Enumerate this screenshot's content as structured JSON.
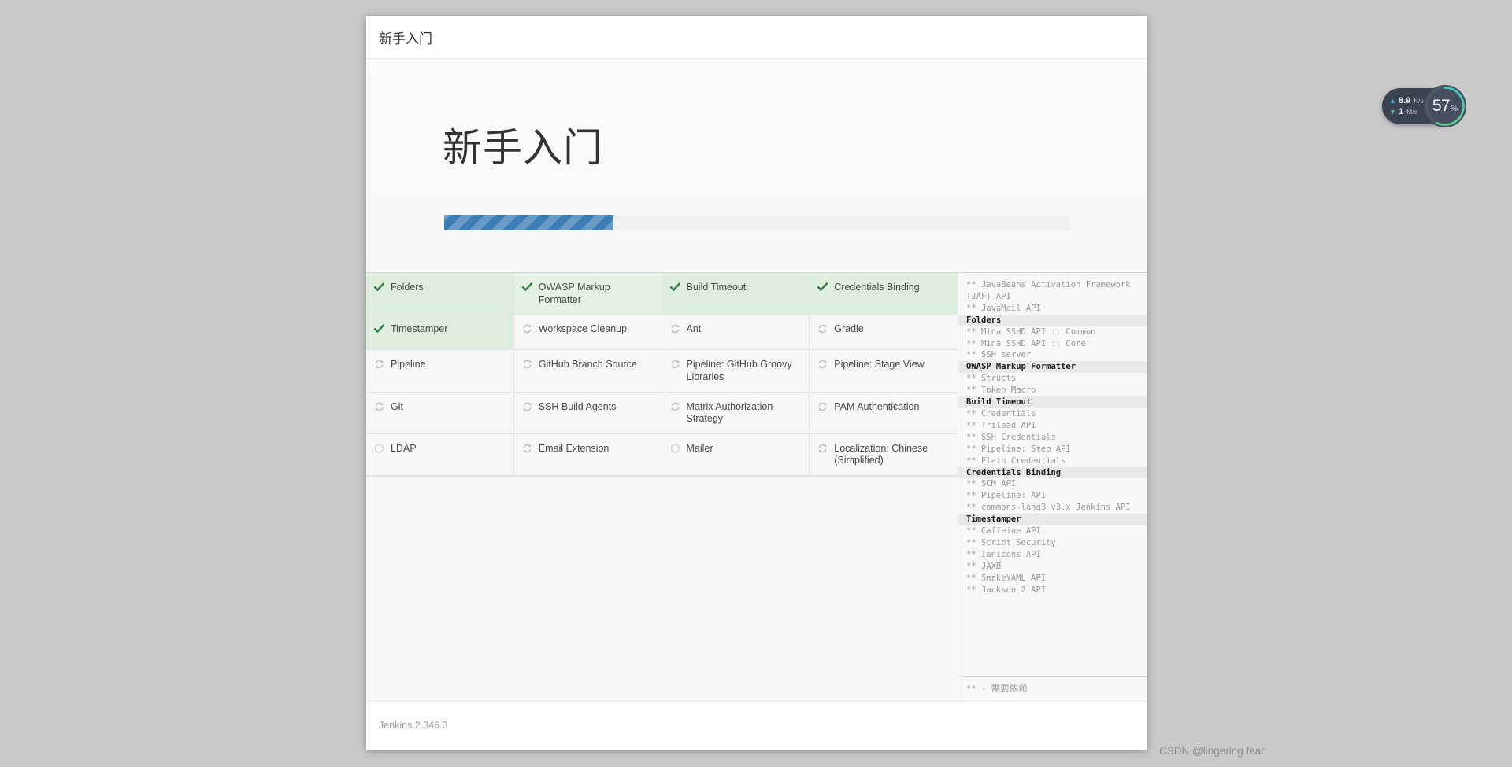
{
  "window": {
    "breadcrumb": "新手入门",
    "hero_title": "新手入门",
    "progress_percent": 27,
    "footer_version": "Jenkins 2.346.3"
  },
  "plugins": [
    {
      "name": "Folders",
      "status": "done"
    },
    {
      "name": "OWASP Markup Formatter",
      "status": "done"
    },
    {
      "name": "Build Timeout",
      "status": "done"
    },
    {
      "name": "Credentials Binding",
      "status": "done"
    },
    {
      "name": "Timestamper",
      "status": "done"
    },
    {
      "name": "Workspace Cleanup",
      "status": "installing"
    },
    {
      "name": "Ant",
      "status": "installing"
    },
    {
      "name": "Gradle",
      "status": "installing"
    },
    {
      "name": "Pipeline",
      "status": "installing"
    },
    {
      "name": "GitHub Branch Source",
      "status": "installing"
    },
    {
      "name": "Pipeline: GitHub Groovy Libraries",
      "status": "installing"
    },
    {
      "name": "Pipeline: Stage View",
      "status": "installing"
    },
    {
      "name": "Git",
      "status": "installing"
    },
    {
      "name": "SSH Build Agents",
      "status": "installing"
    },
    {
      "name": "Matrix Authorization Strategy",
      "status": "installing"
    },
    {
      "name": "PAM Authentication",
      "status": "installing"
    },
    {
      "name": "LDAP",
      "status": "pending"
    },
    {
      "name": "Email Extension",
      "status": "installing"
    },
    {
      "name": "Mailer",
      "status": "pending"
    },
    {
      "name": "Localization: Chinese (Simplified)",
      "status": "installing"
    }
  ],
  "install_log": {
    "lines": [
      {
        "text": "** JavaBeans Activation Framework (JAF) API",
        "type": "dep"
      },
      {
        "text": "** JavaMail API",
        "type": "dep"
      },
      {
        "text": "Folders",
        "type": "plug"
      },
      {
        "text": "** Mina SSHD API :: Common",
        "type": "dep"
      },
      {
        "text": "** Mina SSHD API :: Core",
        "type": "dep"
      },
      {
        "text": "** SSH server",
        "type": "dep"
      },
      {
        "text": "OWASP Markup Formatter",
        "type": "plug"
      },
      {
        "text": "** Structs",
        "type": "dep"
      },
      {
        "text": "** Token Macro",
        "type": "dep"
      },
      {
        "text": "Build Timeout",
        "type": "plug"
      },
      {
        "text": "** Credentials",
        "type": "dep"
      },
      {
        "text": "** Trilead API",
        "type": "dep"
      },
      {
        "text": "** SSH Credentials",
        "type": "dep"
      },
      {
        "text": "** Pipeline: Step API",
        "type": "dep"
      },
      {
        "text": "** Plain Credentials",
        "type": "dep"
      },
      {
        "text": "Credentials Binding",
        "type": "plug"
      },
      {
        "text": "** SCM API",
        "type": "dep"
      },
      {
        "text": "** Pipeline: API",
        "type": "dep"
      },
      {
        "text": "** commons-lang3 v3.x Jenkins API",
        "type": "dep"
      },
      {
        "text": "Timestamper",
        "type": "plug"
      },
      {
        "text": "** Caffeine API",
        "type": "dep"
      },
      {
        "text": "** Script Security",
        "type": "dep"
      },
      {
        "text": "** Ionicons API",
        "type": "dep"
      },
      {
        "text": "** JAXB",
        "type": "dep"
      },
      {
        "text": "** SnakeYAML API",
        "type": "dep"
      },
      {
        "text": "** Jackson 2 API",
        "type": "dep"
      }
    ],
    "legend_marker": "**",
    "legend_dash": "-",
    "legend_text": "需要依赖"
  },
  "system_monitor": {
    "upload_value": "8.9",
    "upload_unit": "K/s",
    "download_value": "1",
    "download_unit": "M/s",
    "cpu_value": "57",
    "cpu_unit": "%",
    "cpu_percent": 57,
    "up_arrow": "▲",
    "down_arrow": "▼"
  },
  "watermark": "CSDN @lingering fear",
  "colors": {
    "progress_fill": "#3d7db5",
    "done_cell": "#ddeedd",
    "check_green": "#2d7a3e",
    "spinner_gray": "#b7c2cc",
    "gauge_start": "#3ec9c9",
    "gauge_end": "#5fd08a"
  }
}
